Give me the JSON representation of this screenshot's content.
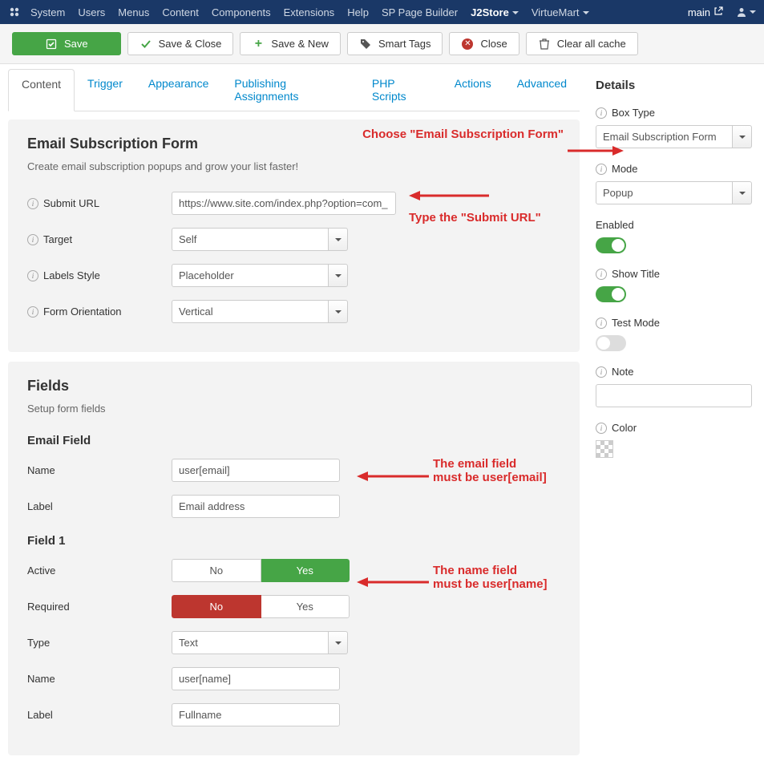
{
  "topbar": {
    "menus": [
      "System",
      "Users",
      "Menus",
      "Content",
      "Components",
      "Extensions",
      "Help",
      "SP Page Builder",
      "J2Store",
      "VirtueMart"
    ],
    "caret_idx": [
      8,
      9
    ],
    "active_idx": 8,
    "site_name": "main"
  },
  "toolbar": {
    "save": "Save",
    "save_close": "Save & Close",
    "save_new": "Save & New",
    "smart_tags": "Smart Tags",
    "close": "Close",
    "clear_cache": "Clear all cache"
  },
  "tabs": [
    "Content",
    "Trigger",
    "Appearance",
    "Publishing Assignments",
    "PHP Scripts",
    "Actions",
    "Advanced"
  ],
  "active_tab": 0,
  "panel1": {
    "title": "Email Subscription Form",
    "desc": "Create email subscription popups and grow your list faster!",
    "submit_url_label": "Submit URL",
    "submit_url_value": "https://www.site.com/index.php?option=com_",
    "target_label": "Target",
    "target_value": "Self",
    "labels_style_label": "Labels Style",
    "labels_style_value": "Placeholder",
    "orientation_label": "Form Orientation",
    "orientation_value": "Vertical"
  },
  "panel2": {
    "title": "Fields",
    "desc": "Setup form fields",
    "email_field_h": "Email Field",
    "name_label": "Name",
    "email_name_value": "user[email]",
    "label_label": "Label",
    "email_label_value": "Email address",
    "field1_h": "Field 1",
    "active_label": "Active",
    "required_label": "Required",
    "no": "No",
    "yes": "Yes",
    "type_label": "Type",
    "type_value": "Text",
    "field1_name_value": "user[name]",
    "field1_label_value": "Fullname"
  },
  "ann": {
    "a1": "Choose \"Email Subscription Form\"",
    "a2": "Type the \"Submit URL\"",
    "a3": "The email field\nmust be user[email]",
    "a4": "The name field\nmust be user[name]"
  },
  "details": {
    "title": "Details",
    "box_type_label": "Box Type",
    "box_type_value": "Email Subscription Form",
    "mode_label": "Mode",
    "mode_value": "Popup",
    "enabled_label": "Enabled",
    "enabled_on": true,
    "show_title_label": "Show Title",
    "show_title_on": true,
    "test_mode_label": "Test Mode",
    "test_mode_on": false,
    "note_label": "Note",
    "color_label": "Color"
  }
}
